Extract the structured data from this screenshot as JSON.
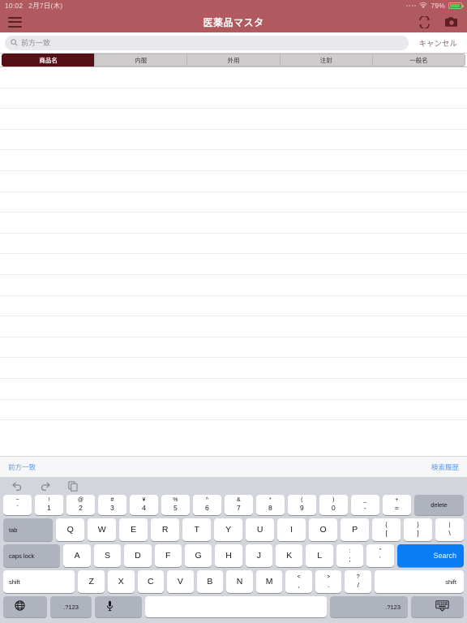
{
  "statusbar": {
    "time": "10:02",
    "date": "2月7日(木)",
    "wifi_icon": "wifi-icon",
    "battery_percent": "79%",
    "battery_icon": "battery-charging-icon"
  },
  "navbar": {
    "menu_icon": "hamburger-menu-icon",
    "title": "医薬品マスタ",
    "sync_icon": "sync-refresh-icon",
    "camera_icon": "camera-icon"
  },
  "search": {
    "search_icon": "search-icon",
    "placeholder": "前方一致",
    "value": "",
    "cancel_label": "キャンセル"
  },
  "segments": [
    {
      "label": "商品名",
      "active": true
    },
    {
      "label": "内服",
      "active": false
    },
    {
      "label": "外用",
      "active": false
    },
    {
      "label": "注射",
      "active": false
    },
    {
      "label": "一般名",
      "active": false
    }
  ],
  "list": {
    "rows": 17,
    "items": []
  },
  "bottombar": {
    "left_label": "前方一致",
    "right_label": "検索履歴"
  },
  "keyboard": {
    "toolbar": [
      {
        "name": "undo-icon"
      },
      {
        "name": "redo-icon"
      },
      {
        "name": "paste-icon"
      }
    ],
    "row_numbers": [
      {
        "up": "~",
        "lo": "`"
      },
      {
        "up": "!",
        "lo": "1"
      },
      {
        "up": "@",
        "lo": "2"
      },
      {
        "up": "#",
        "lo": "3"
      },
      {
        "up": "¥",
        "lo": "4"
      },
      {
        "up": "%",
        "lo": "5"
      },
      {
        "up": "^",
        "lo": "6"
      },
      {
        "up": "&",
        "lo": "7"
      },
      {
        "up": "*",
        "lo": "8"
      },
      {
        "up": "(",
        "lo": "9"
      },
      {
        "up": ")",
        "lo": "0"
      },
      {
        "up": "_",
        "lo": "-"
      },
      {
        "up": "+",
        "lo": "="
      }
    ],
    "delete_label": "delete",
    "tab_label": "tab",
    "row_q": [
      "Q",
      "W",
      "E",
      "R",
      "T",
      "Y",
      "U",
      "I",
      "O",
      "P"
    ],
    "row_q_dual": [
      {
        "up": "{",
        "lo": "["
      },
      {
        "up": "}",
        "lo": "]"
      },
      {
        "up": "|",
        "lo": "\\"
      }
    ],
    "caps_label": "caps lock",
    "row_a": [
      "A",
      "S",
      "D",
      "F",
      "G",
      "H",
      "J",
      "K",
      "L"
    ],
    "row_a_dual": [
      {
        "up": ":",
        "lo": ";"
      },
      {
        "up": "”",
        "lo": "’"
      }
    ],
    "search_label": "Search",
    "shift_left_label": "shift",
    "row_z": [
      "Z",
      "X",
      "C",
      "V",
      "B",
      "N",
      "M"
    ],
    "row_z_dual": [
      {
        "up": "<",
        "lo": ","
      },
      {
        "up": ">",
        "lo": "."
      },
      {
        "up": "?",
        "lo": "/"
      }
    ],
    "shift_right_label": "shift",
    "globe_icon": "globe-language-icon",
    "num_left_label": ".?123",
    "mic_icon": "microphone-icon",
    "space_label": "",
    "num_right_label": ".?123",
    "dismiss_icon": "keyboard-dismiss-icon"
  },
  "colors": {
    "nav_bg": "#b05a60",
    "segment_active": "#551015",
    "accent_blue": "#0a7cf4",
    "link_blue": "#5b9bf5",
    "keyboard_bg": "#d2d5db"
  }
}
